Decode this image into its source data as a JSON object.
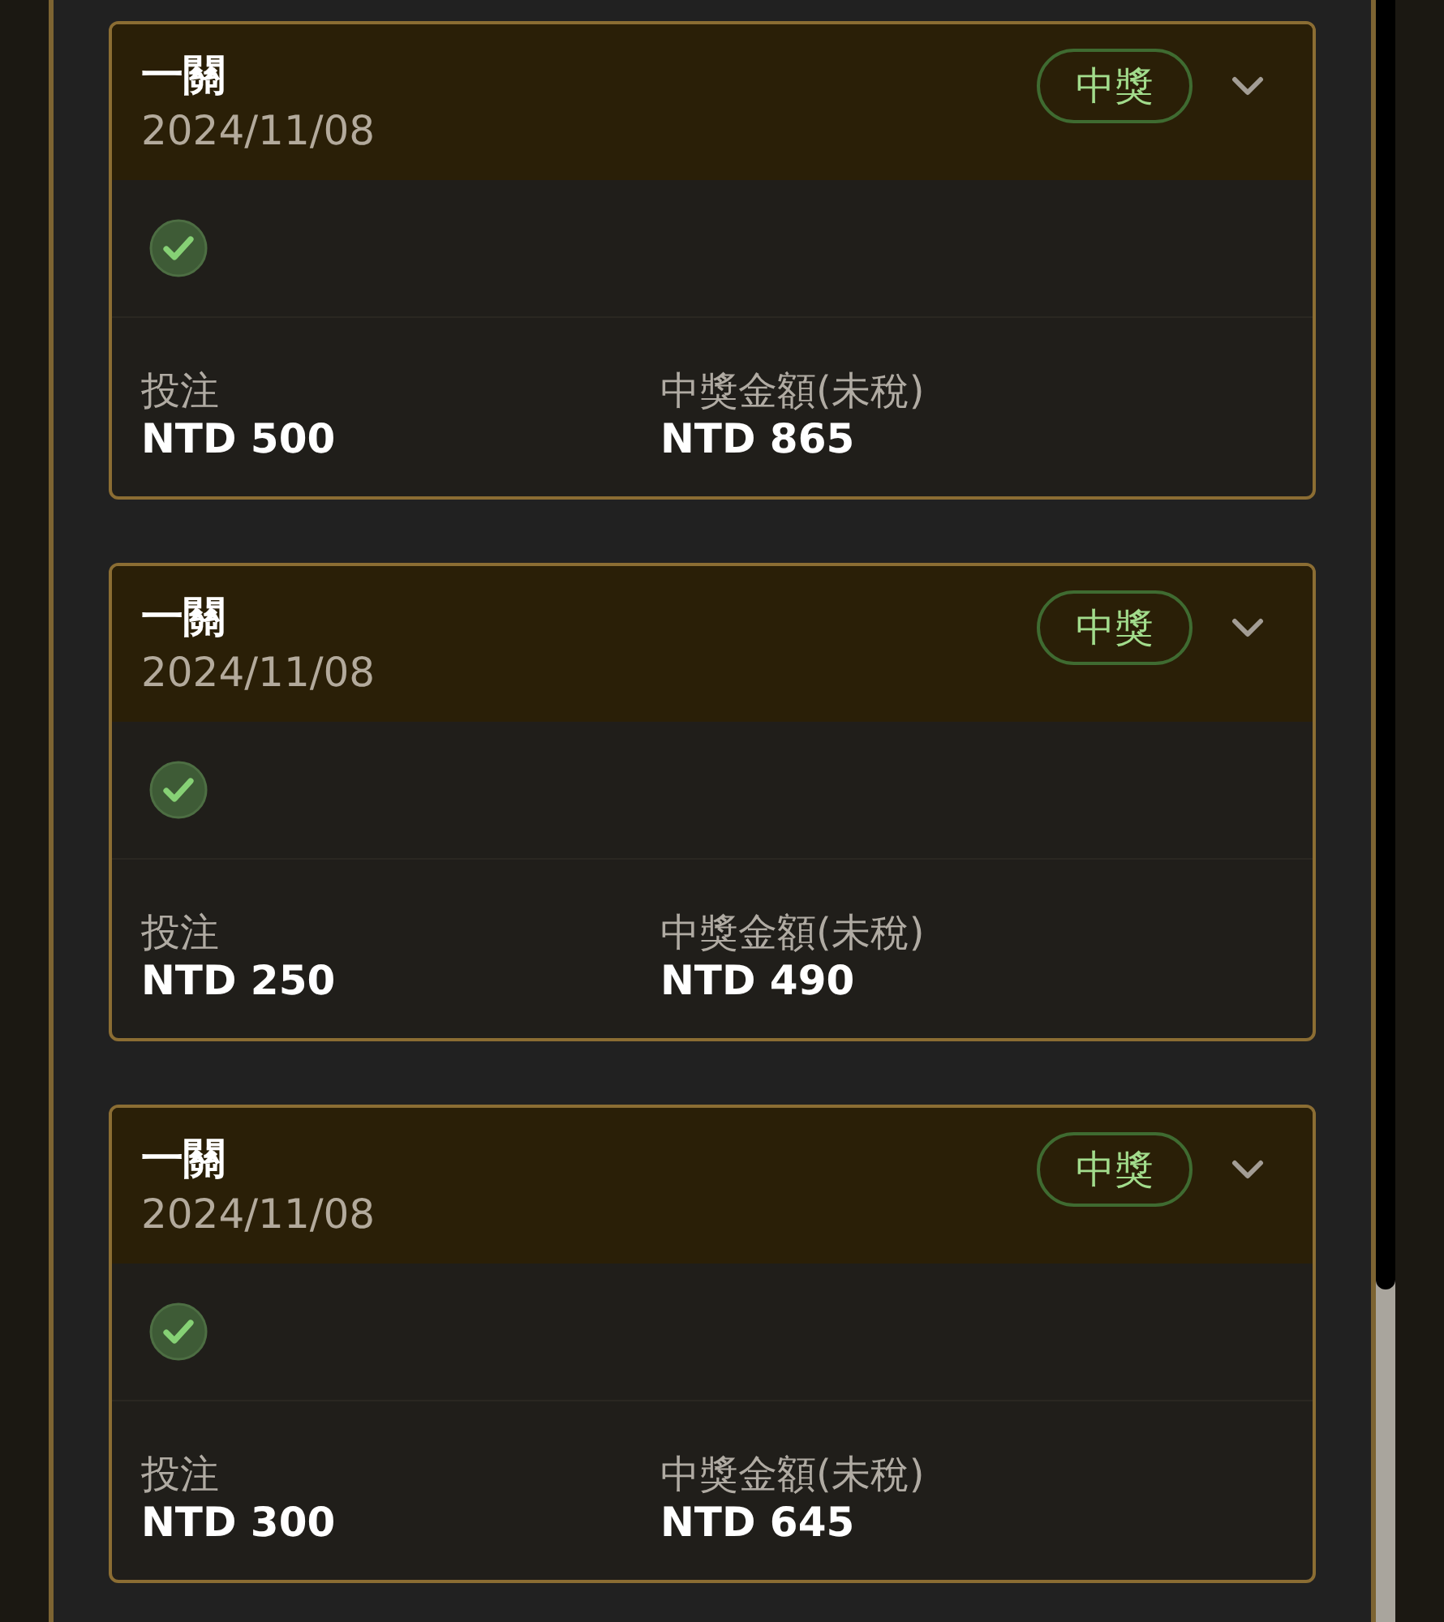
{
  "records": [
    {
      "title": "一關",
      "date": "2024/11/08",
      "badge": "中獎",
      "stake_label": "投注",
      "stake": "NTD 500",
      "prize_label": "中獎金額(未稅)",
      "prize": "NTD 865"
    },
    {
      "title": "一關",
      "date": "2024/11/08",
      "badge": "中獎",
      "stake_label": "投注",
      "stake": "NTD 250",
      "prize_label": "中獎金額(未稅)",
      "prize": "NTD 490"
    },
    {
      "title": "一關",
      "date": "2024/11/08",
      "badge": "中獎",
      "stake_label": "投注",
      "stake": "NTD 300",
      "prize_label": "中獎金額(未稅)",
      "prize": "NTD 645"
    }
  ]
}
